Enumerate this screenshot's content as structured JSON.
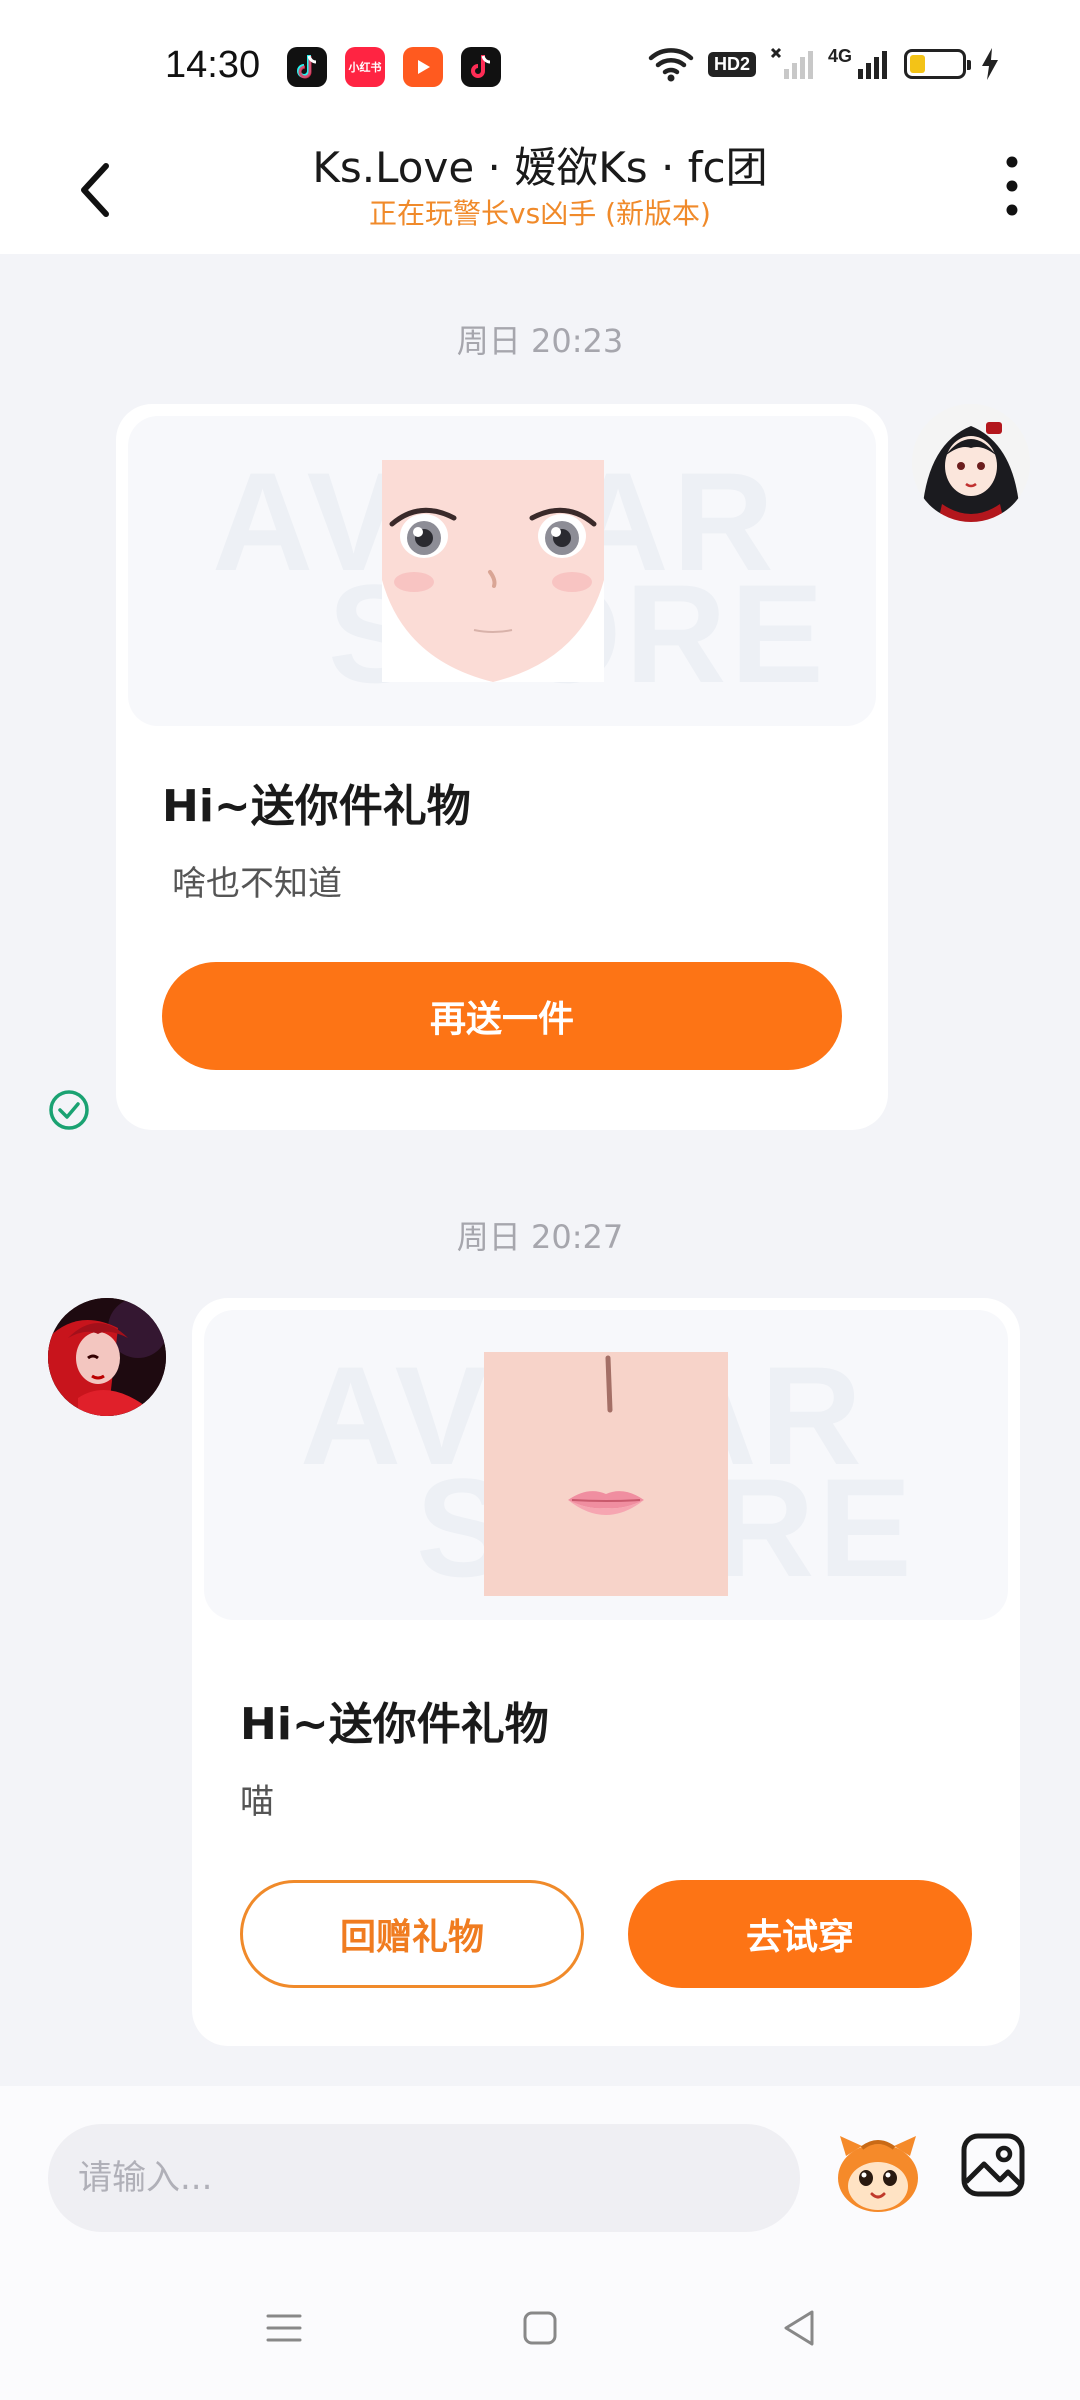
{
  "status_bar": {
    "time": "14:30",
    "apps": [
      {
        "name": "tiktok-app-icon",
        "color": "#111111",
        "glyph": "♪"
      },
      {
        "name": "xiaohongshu-app-icon",
        "color": "#ff2442",
        "glyph": "小红书"
      },
      {
        "name": "video-app-icon",
        "color": "#ff5a1f",
        "glyph": "▶"
      },
      {
        "name": "tiktok-app-icon-2",
        "color": "#111111",
        "glyph": "♪"
      }
    ],
    "hd_label": "HD2",
    "network_label": "4G",
    "battery_level": 0.3
  },
  "header": {
    "title": "Ks.Love · 嫒欲Ks · fc团",
    "subtitle": "正在玩警长vs凶手 (新版本)"
  },
  "messages": [
    {
      "timestamp": "周日 20:23",
      "sender": "self",
      "watermark_top": "AVATAR",
      "watermark_bottom": "STORE",
      "title": "Hi~送你件礼物",
      "text": "啥也不知道",
      "button_primary": "再送一件",
      "read": true
    },
    {
      "timestamp": "周日 20:27",
      "sender": "other",
      "watermark_top": "AVATAR",
      "watermark_bottom": "STORE",
      "title": "Hi~送你件礼物",
      "text": "喵",
      "button_secondary": "回赠礼物",
      "button_primary": "去试穿"
    }
  ],
  "input": {
    "placeholder": "请输入..."
  },
  "colors": {
    "accent": "#fd7415",
    "subtitle": "#f08a2a",
    "background": "#f3f4f8",
    "read_check": "#1aa272"
  }
}
